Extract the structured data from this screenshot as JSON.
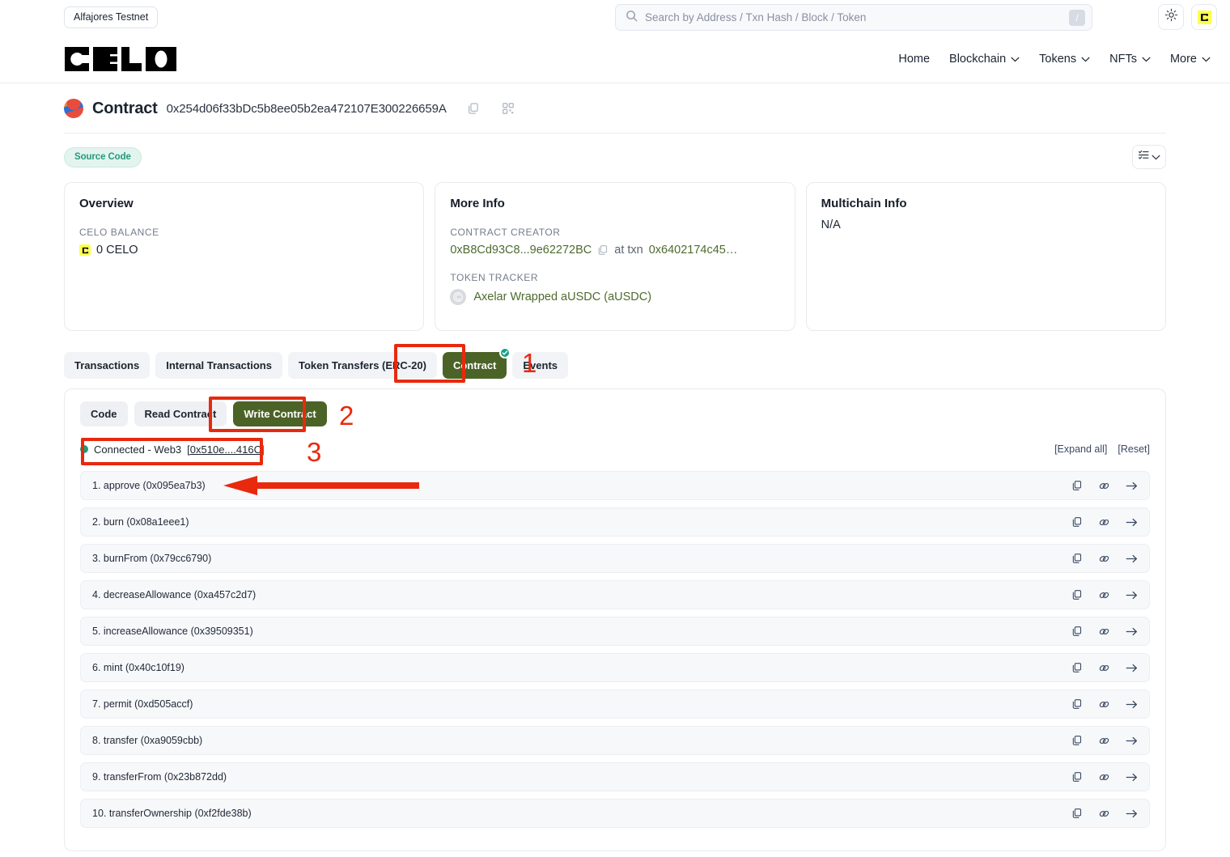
{
  "topbar": {
    "network_label": "Alfajores Testnet",
    "search_placeholder": "Search by Address / Txn Hash / Block / Token",
    "search_value": "",
    "slash_hint": "/",
    "theme_icon": "sun-icon",
    "brand_icon": "celo-logo-icon"
  },
  "nav": {
    "brand": "CELO",
    "items": [
      {
        "label": "Home",
        "caret": false
      },
      {
        "label": "Blockchain",
        "caret": true
      },
      {
        "label": "Tokens",
        "caret": true
      },
      {
        "label": "NFTs",
        "caret": true
      },
      {
        "label": "More",
        "caret": true
      }
    ]
  },
  "contract_header": {
    "title": "Contract",
    "address": "0x254d06f33bDc5b8ee05b2ea472107E300226659A",
    "copy_icon": "copy-icon",
    "qr_icon": "qr-code-icon"
  },
  "badge_row": {
    "source_code_badge": "Source Code",
    "listview_icon": "list-checklist-icon",
    "listview_caret_icon": "chevron-down-icon"
  },
  "cards": {
    "overview": {
      "title": "Overview",
      "balance_label": "CELO BALANCE",
      "balance_value": "0 CELO",
      "balance_icon": "celo-token-icon"
    },
    "more_info": {
      "title": "More Info",
      "creator_label": "CONTRACT CREATOR",
      "creator_address": "0xB8Cd93C8...9e62272BC",
      "creator_copy_icon": "copy-icon",
      "at_txn_text": "at txn",
      "creator_txn": "0x6402174c45…",
      "token_tracker_label": "TOKEN TRACKER",
      "token_name": "Axelar Wrapped aUSDC (aUSDC)",
      "token_icon": "token-logo-icon"
    },
    "multichain": {
      "title": "Multichain Info",
      "value": "N/A"
    }
  },
  "tabs": [
    {
      "label": "Transactions",
      "active": false
    },
    {
      "label": "Internal Transactions",
      "active": false
    },
    {
      "label": "Token Transfers (ERC-20)",
      "active": false
    },
    {
      "label": "Contract",
      "active": true
    },
    {
      "label": "Events",
      "active": false
    }
  ],
  "subtabs": [
    {
      "label": "Code",
      "active": false
    },
    {
      "label": "Read Contract",
      "active": false
    },
    {
      "label": "Write Contract",
      "active": true
    }
  ],
  "connection": {
    "status_text": "Connected - Web3",
    "wallet_address": "[0x510e....416C]",
    "status_color": "#12a37b"
  },
  "panel_actions": {
    "expand_all": "[Expand all]",
    "reset": "[Reset]"
  },
  "functions": [
    {
      "label": "1. approve (0x095ea7b3)"
    },
    {
      "label": "2. burn (0x08a1eee1)"
    },
    {
      "label": "3. burnFrom (0x79cc6790)"
    },
    {
      "label": "4. decreaseAllowance (0xa457c2d7)"
    },
    {
      "label": "5. increaseAllowance (0x39509351)"
    },
    {
      "label": "6. mint (0x40c10f19)"
    },
    {
      "label": "7. permit (0xd505accf)"
    },
    {
      "label": "8. transfer (0xa9059cbb)"
    },
    {
      "label": "9. transferFrom (0x23b872dd)"
    },
    {
      "label": "10. transferOwnership (0xf2fde38b)"
    }
  ],
  "function_row_icons": {
    "copy": "copy-icon",
    "link": "chain-link-icon",
    "go": "arrow-right-icon"
  },
  "annotations": {
    "step1": "1",
    "step2": "2",
    "step3": "3",
    "color": "#e8290e"
  },
  "colors": {
    "accent_green": "#4c6327",
    "link_green": "#4d6b2f",
    "badge_teal": "#25997c",
    "celo_yellow": "#fcff52",
    "annotation_red": "#e8290e"
  }
}
